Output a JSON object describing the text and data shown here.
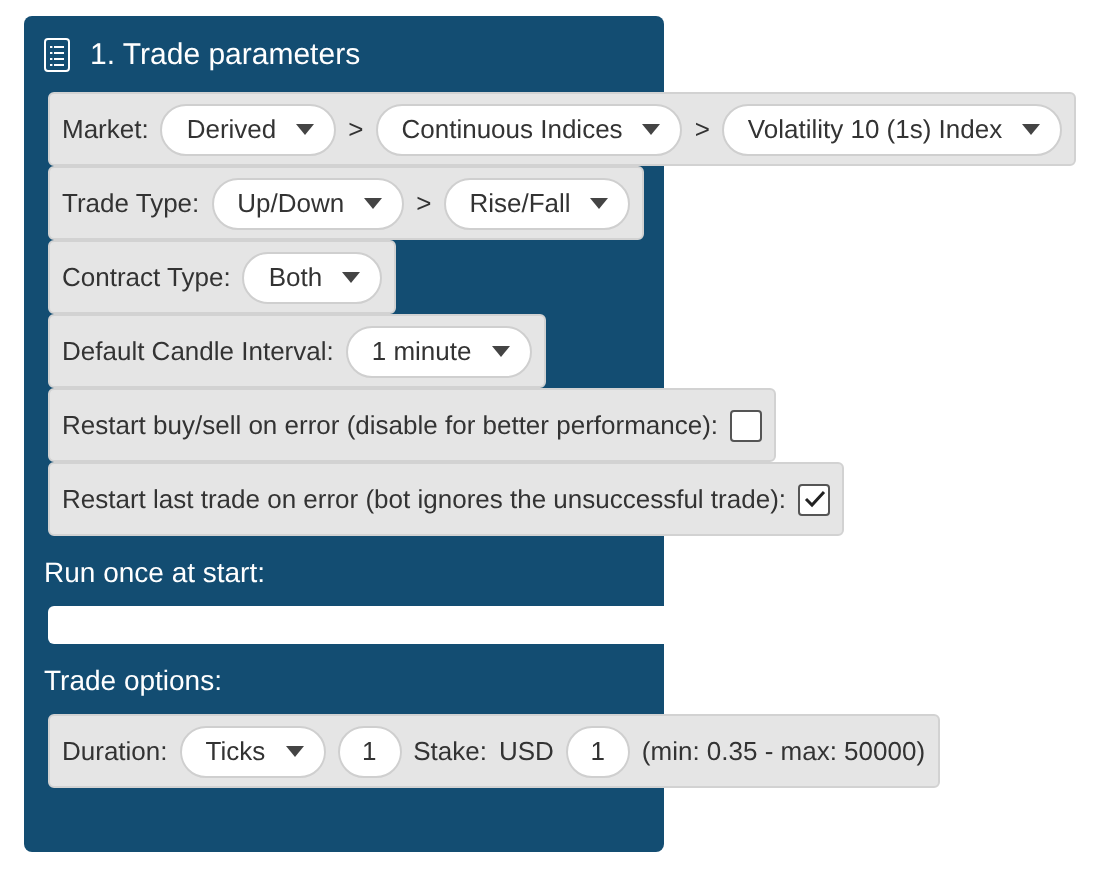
{
  "header": {
    "title": "1. Trade parameters"
  },
  "parameters": [
    {
      "label": "Market:",
      "items": [
        {
          "kind": "dropdown",
          "value": "Derived"
        },
        {
          "kind": "separator",
          "text": ">"
        },
        {
          "kind": "dropdown",
          "value": "Continuous Indices"
        },
        {
          "kind": "separator",
          "text": ">"
        },
        {
          "kind": "dropdown",
          "value": "Volatility 10 (1s) Index"
        }
      ]
    },
    {
      "label": "Trade Type:",
      "items": [
        {
          "kind": "dropdown",
          "value": "Up/Down"
        },
        {
          "kind": "separator",
          "text": ">"
        },
        {
          "kind": "dropdown",
          "value": "Rise/Fall"
        }
      ]
    },
    {
      "label": "Contract Type:",
      "items": [
        {
          "kind": "dropdown",
          "value": "Both"
        }
      ]
    },
    {
      "label": "Default Candle Interval:",
      "items": [
        {
          "kind": "dropdown",
          "value": "1 minute"
        }
      ]
    },
    {
      "label": "Restart buy/sell on error (disable for better performance):",
      "items": [
        {
          "kind": "checkbox",
          "checked": false
        }
      ]
    },
    {
      "label": "Restart last trade on error (bot ignores the unsuccessful trade):",
      "items": [
        {
          "kind": "checkbox",
          "checked": true
        }
      ]
    }
  ],
  "run_once": {
    "label": "Run once at start:"
  },
  "trade_options": {
    "label": "Trade options:",
    "items": [
      {
        "kind": "label",
        "text": "Duration:"
      },
      {
        "kind": "dropdown",
        "value": "Ticks"
      },
      {
        "kind": "number",
        "value": "1"
      },
      {
        "kind": "label",
        "text": "Stake:"
      },
      {
        "kind": "label",
        "text": "USD"
      },
      {
        "kind": "number",
        "value": "1"
      },
      {
        "kind": "label",
        "text": "(min: 0.35 - max: 50000)"
      }
    ]
  }
}
